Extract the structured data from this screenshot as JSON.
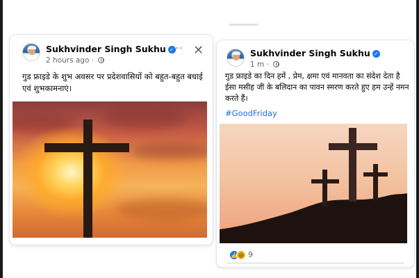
{
  "left_post": {
    "author": "Sukhvinder Singh Sukhu",
    "timestamp": "2 hours ago · ",
    "more_label": "···",
    "close_label": "✕",
    "text": "गुड फ्राइडे के शुभ अवसर पर प्रदेशवासियों को बहुत-बहुत बधाई एवं शुभकामनाएं।",
    "image": "sunset-cross-image"
  },
  "right_post": {
    "author": "Sukhvinder Singh Sukhu",
    "timestamp": "1 m · ",
    "text": "गुड फ्राइडे का दिन हमें  , प्रेम, क्षमा एवं मानवता का संदेश देता है ईसा मसीह जी के बलिदान का पावन स्मरण करते हुए  हम उन्हें नमन करते हैं।",
    "hashtag": "#GoodFriday",
    "image": "three-crosses-hill-image",
    "reaction_count": "9"
  },
  "icons": {
    "verified": "verified-badge-icon",
    "globe": "globe-icon",
    "like": "like-reaction-icon",
    "haha": "haha-reaction-icon"
  },
  "colors": {
    "link": "#216fdb",
    "verified": "#1877f2",
    "meta": "#65676b"
  }
}
